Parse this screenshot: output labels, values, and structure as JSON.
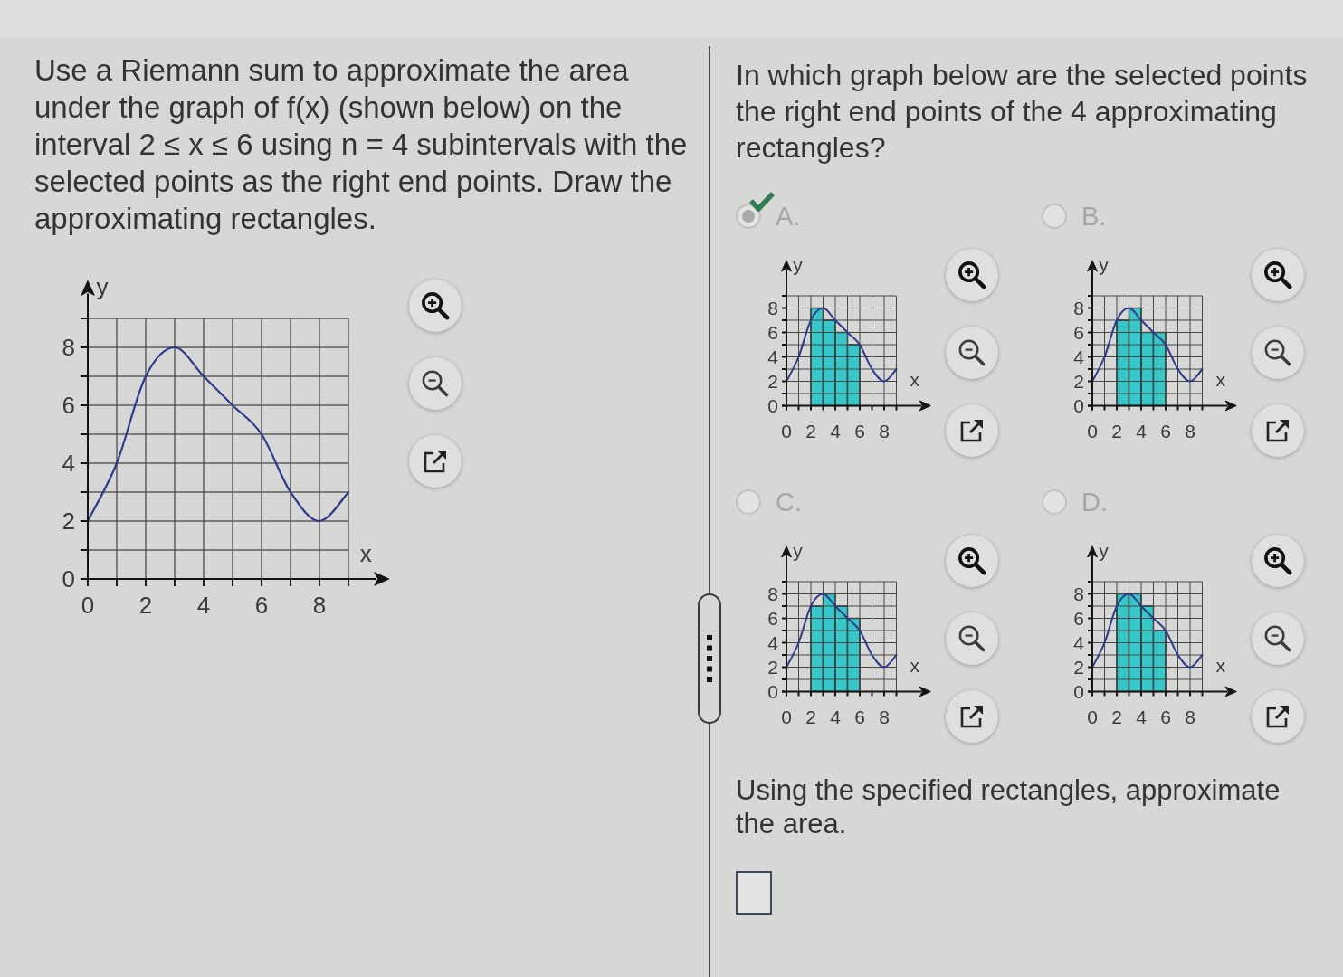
{
  "left_panel": {
    "prompt": "Use a Riemann sum to approximate the area under the graph of f(x) (shown below) on the interval 2 ≤ x ≤ 6 using n = 4 subintervals with the selected points as the right end points. Draw the approximating rectangles.",
    "graph": {
      "chart_data": {
        "type": "line",
        "xlabel": "x",
        "ylabel": "y",
        "x": [
          0,
          1,
          2,
          3,
          4,
          5,
          6,
          7,
          8,
          9
        ],
        "values": [
          2,
          4,
          7,
          8,
          7,
          6,
          5,
          3,
          2,
          3
        ],
        "color": "#2b3a8c",
        "xticks": [
          0,
          2,
          4,
          6,
          8
        ],
        "yticks": [
          0,
          2,
          4,
          6,
          8
        ],
        "xlim": [
          0,
          9
        ],
        "ylim": [
          0,
          9
        ],
        "grid": true
      }
    }
  },
  "right_panel": {
    "question": "In which graph below are the selected points the right end points of the 4 approximating rectangles?",
    "options": [
      {
        "label": "A.",
        "selected": true,
        "correct": true,
        "disabled": true,
        "chart_data": {
          "type": "bar",
          "xlabel": "x",
          "ylabel": "y",
          "series": [
            {
              "x": [
                2.5,
                3.5,
                4.5,
                5.5
              ],
              "values": [
                8,
                7,
                6,
                5
              ],
              "color": "#36c8c8"
            },
            {
              "type": "line",
              "x": [
                0,
                1,
                2,
                3,
                4,
                5,
                6,
                7,
                8,
                9
              ],
              "values": [
                2,
                4,
                7,
                8,
                7,
                6,
                5,
                3,
                2,
                3
              ],
              "color": "#2b3a8c"
            }
          ],
          "xticks": [
            0,
            2,
            4,
            6,
            8
          ],
          "yticks": [
            0,
            2,
            4,
            6,
            8
          ],
          "xlim": [
            0,
            9
          ],
          "ylim": [
            0,
            9
          ],
          "grid": true
        }
      },
      {
        "label": "B.",
        "selected": false,
        "correct": false,
        "disabled": true,
        "chart_data": {
          "type": "bar",
          "xlabel": "x",
          "ylabel": "y",
          "series": [
            {
              "x": [
                2.5,
                3.5,
                4.5,
                5.5
              ],
              "values": [
                7,
                8,
                6,
                6
              ],
              "color": "#36c8c8"
            },
            {
              "type": "line",
              "x": [
                0,
                1,
                2,
                3,
                4,
                5,
                6,
                7,
                8,
                9
              ],
              "values": [
                2,
                4,
                7,
                8,
                7,
                6,
                5,
                3,
                2,
                3
              ],
              "color": "#2b3a8c"
            }
          ],
          "xticks": [
            0,
            2,
            4,
            6,
            8
          ],
          "yticks": [
            0,
            2,
            4,
            6,
            8
          ],
          "xlim": [
            0,
            9
          ],
          "ylim": [
            0,
            9
          ],
          "grid": true
        }
      },
      {
        "label": "C.",
        "selected": false,
        "correct": false,
        "disabled": true,
        "chart_data": {
          "type": "bar",
          "xlabel": "x",
          "ylabel": "y",
          "series": [
            {
              "x": [
                2.5,
                3.5,
                4.5,
                5.5
              ],
              "values": [
                7,
                8,
                7,
                6
              ],
              "color": "#36c8c8"
            },
            {
              "type": "line",
              "x": [
                0,
                1,
                2,
                3,
                4,
                5,
                6,
                7,
                8,
                9
              ],
              "values": [
                2,
                4,
                7,
                8,
                7,
                6,
                5,
                3,
                2,
                3
              ],
              "color": "#2b3a8c"
            }
          ],
          "xticks": [
            0,
            2,
            4,
            6,
            8
          ],
          "yticks": [
            0,
            2,
            4,
            6,
            8
          ],
          "xlim": [
            0,
            9
          ],
          "ylim": [
            0,
            9
          ],
          "grid": true
        }
      },
      {
        "label": "D.",
        "selected": false,
        "correct": false,
        "disabled": true,
        "chart_data": {
          "type": "bar",
          "xlabel": "x",
          "ylabel": "y",
          "series": [
            {
              "x": [
                2.5,
                3.5,
                4.5,
                5.5
              ],
              "values": [
                8,
                8,
                7,
                5
              ],
              "color": "#36c8c8"
            },
            {
              "type": "line",
              "x": [
                0,
                1,
                2,
                3,
                4,
                5,
                6,
                7,
                8,
                9
              ],
              "values": [
                2,
                4,
                7,
                8,
                7,
                6,
                5,
                3,
                2,
                3
              ],
              "color": "#2b3a8c"
            }
          ],
          "xticks": [
            0,
            2,
            4,
            6,
            8
          ],
          "yticks": [
            0,
            2,
            4,
            6,
            8
          ],
          "xlim": [
            0,
            9
          ],
          "ylim": [
            0,
            9
          ],
          "grid": true
        }
      }
    ],
    "follow_up": "Using the specified rectangles, approximate the area."
  }
}
